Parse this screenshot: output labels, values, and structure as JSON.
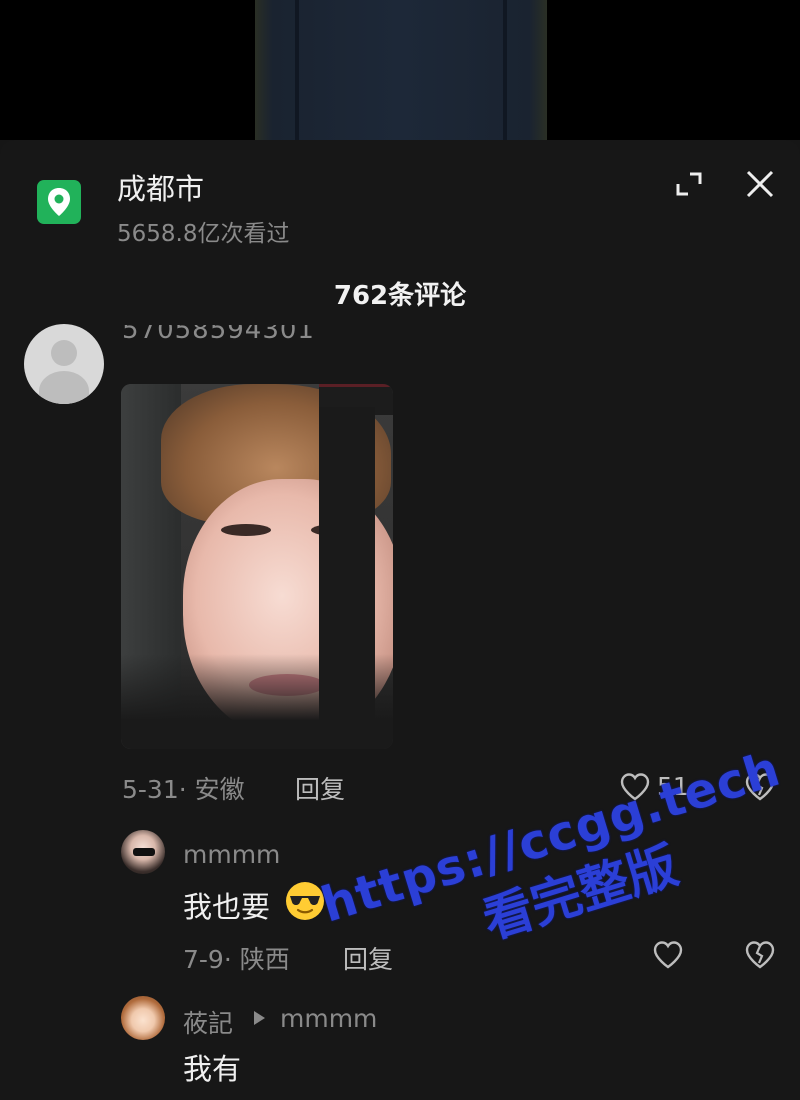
{
  "location": {
    "name": "成都市",
    "views": "5658.8亿次看过"
  },
  "comments_header": "762条评论",
  "comment": {
    "username": "57058594301",
    "date_region": "5-31· 安徽",
    "reply_label": "回复",
    "likes": "51",
    "replies": [
      {
        "username": "mmmm",
        "text": "我也要",
        "emoji": "smiling-face-with-sunglasses",
        "date_region": "7-9· 陕西",
        "reply_label": "回复"
      },
      {
        "username": "莜記",
        "reply_to": "mmmm",
        "text": "我有"
      }
    ]
  },
  "watermark": {
    "line1": "https://ccgg.tech",
    "line2": "看完整版"
  },
  "colors": {
    "panel_bg": "#171717",
    "location_icon": "#21b25a",
    "watermark": "#2b3fd6"
  }
}
